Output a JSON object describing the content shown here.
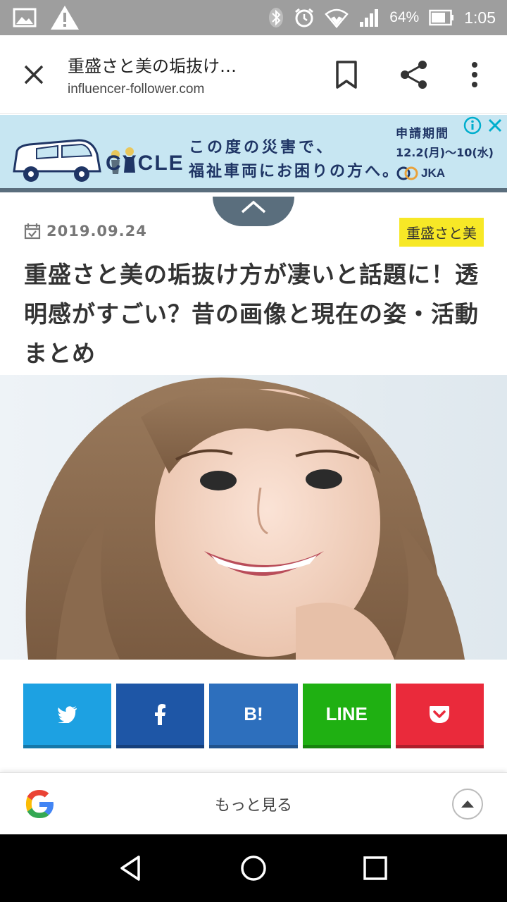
{
  "status_bar": {
    "battery": "64%",
    "time": "1:05"
  },
  "toolbar": {
    "title": "重盛さと美の垢抜け…",
    "url": "influencer-follower.com"
  },
  "ad": {
    "brand": "CYCLE",
    "line1": "この度の災害で、",
    "line2": "福祉車両にお困りの方へ。",
    "period_label": "申請期間",
    "period": "12.2(月)〜10(水)",
    "sponsor": "JKA"
  },
  "article": {
    "date": "2019.09.24",
    "category": "重盛さと美",
    "headline": "重盛さと美の垢抜け方が凄いと話題に！透明感がすごい？昔の画像と現在の姿・活動まとめ"
  },
  "share": {
    "hatena_label": "B!",
    "line_label": "LINE",
    "colors": {
      "twitter": "#1da1e2",
      "facebook": "#1e56a6",
      "hatena": "#2d6fbd",
      "line": "#1fb012",
      "pocket": "#ea2a3b"
    }
  },
  "google_bar": {
    "more_label": "もっと見る"
  }
}
